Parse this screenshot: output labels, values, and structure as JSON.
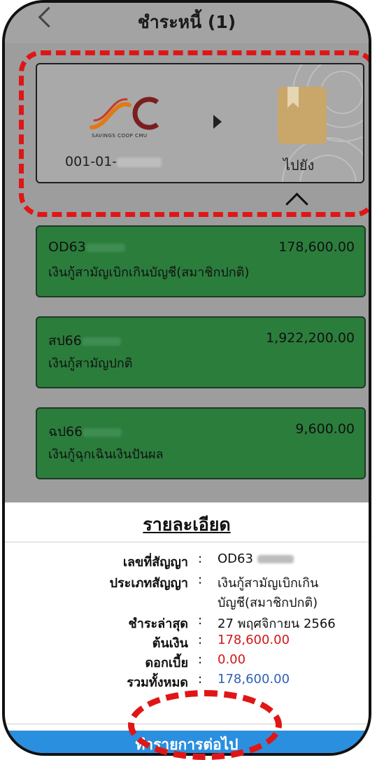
{
  "header": {
    "title": "ชำระหนี้ (1)"
  },
  "account_card": {
    "account_prefix": "001-01-",
    "logo_text": "SAVINGS COOP CMU",
    "goto_label": "ไปยัง"
  },
  "loans": [
    {
      "code": "OD63",
      "amount": "178,600.00",
      "name": "เงินกู้สามัญเบิกเกินบัญชี(สมาชิกปกติ)"
    },
    {
      "code": "สป66",
      "amount": "1,922,200.00",
      "name": "เงินกู้สามัญปกติ"
    },
    {
      "code": "ฉป66",
      "amount": "9,600.00",
      "name": "เงินกู้ฉุกเฉินเงินปันผล"
    }
  ],
  "details": {
    "title": "รายละเอียด",
    "contract_no_label": "เลขที่สัญญา",
    "contract_no_value": "OD63",
    "contract_type_label": "ประเภทสัญญา",
    "contract_type_value_line1": "เงินกู้สามัญเบิกเกิน",
    "contract_type_value_line2": "บัญชี(สมาชิกปกติ)",
    "last_paid_label": "ชำระล่าสุด",
    "last_paid_value": "27 พฤศจิกายน 2566",
    "principal_label": "ต้นเงิน",
    "principal_value": "178,600.00",
    "interest_label": "ดอกเบี้ย",
    "interest_value": "0.00",
    "total_label": "รวมทั้งหมด",
    "total_value": "178,600.00",
    "colon": ":"
  },
  "cta": {
    "label": "ทำรายการต่อไป"
  },
  "colors": {
    "loan_card": "#2b7d3c",
    "highlight": "#e01616",
    "cta": "#2b8fe0",
    "amount_red": "#d01818",
    "amount_blue": "#2f5fb8"
  }
}
